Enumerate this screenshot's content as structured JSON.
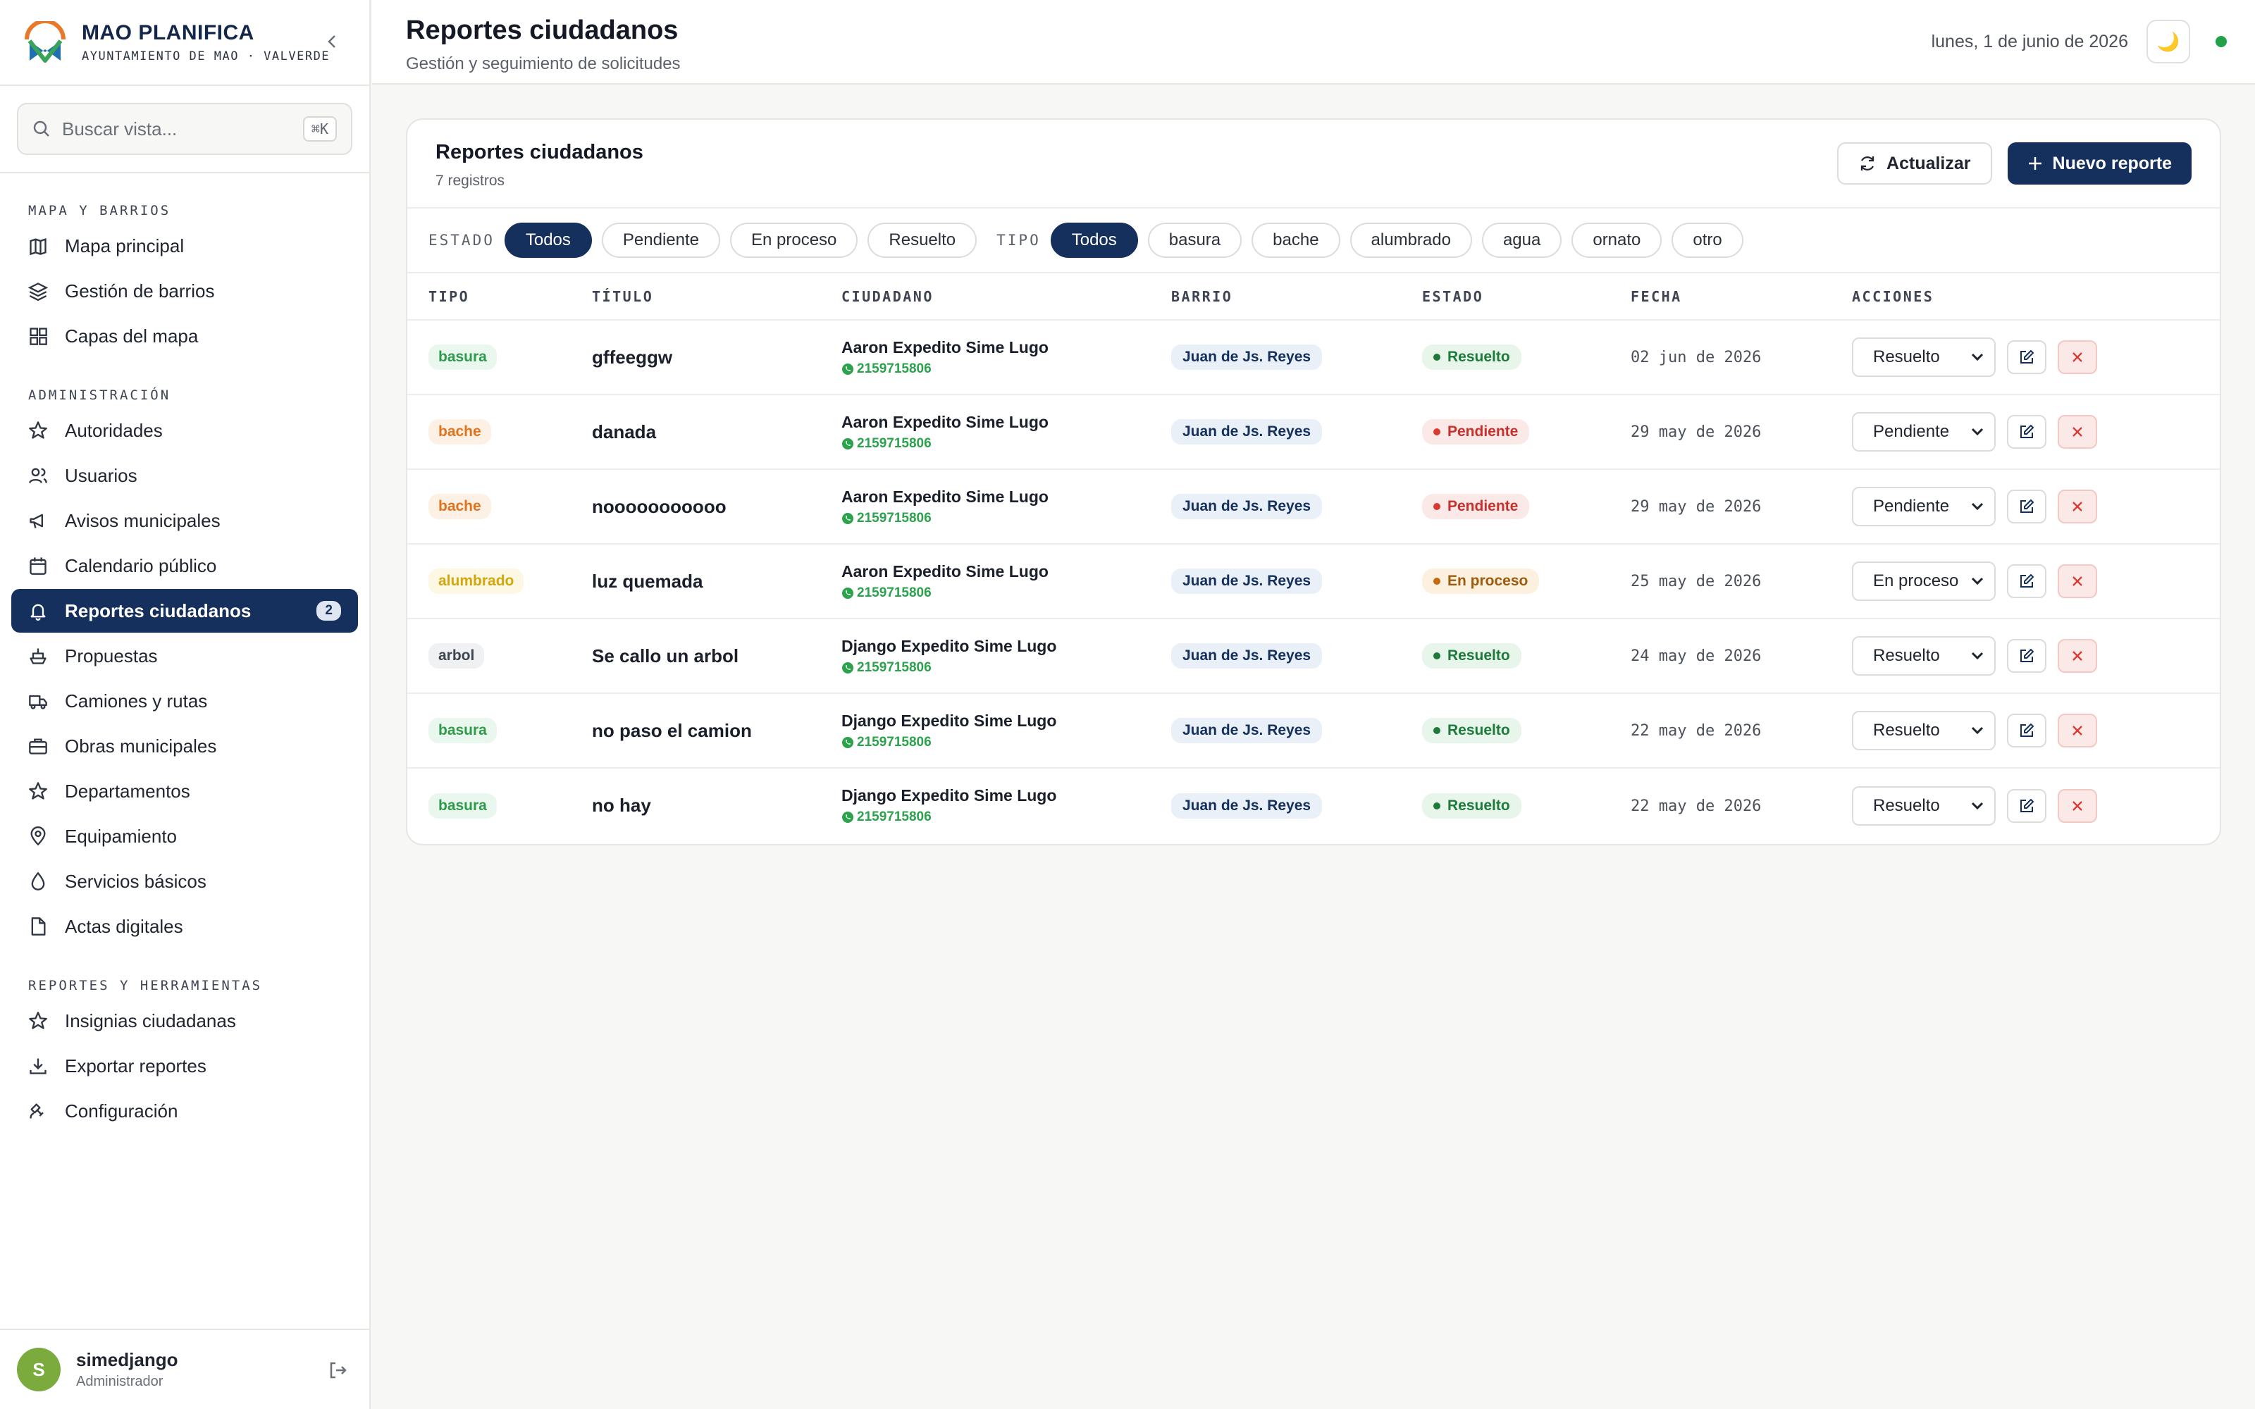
{
  "brand": {
    "title": "MAO PLANIFICA",
    "subtitle": "AYUNTAMIENTO DE MAO · VALVERDE"
  },
  "search": {
    "placeholder": "Buscar vista...",
    "shortcut": "⌘K"
  },
  "nav": [
    {
      "heading": "MAPA Y BARRIOS",
      "items": [
        {
          "label": "Mapa principal",
          "icon": "map-icon"
        },
        {
          "label": "Gestión de barrios",
          "icon": "layers-icon"
        },
        {
          "label": "Capas del mapa",
          "icon": "grid-icon"
        }
      ]
    },
    {
      "heading": "ADMINISTRACIÓN",
      "items": [
        {
          "label": "Autoridades",
          "icon": "star-icon"
        },
        {
          "label": "Usuarios",
          "icon": "users-icon"
        },
        {
          "label": "Avisos municipales",
          "icon": "megaphone-icon"
        },
        {
          "label": "Calendario público",
          "icon": "calendar-icon"
        },
        {
          "label": "Reportes ciudadanos",
          "icon": "bell-icon",
          "active": true,
          "badge": "2"
        },
        {
          "label": "Propuestas",
          "icon": "ship-icon"
        },
        {
          "label": "Camiones y rutas",
          "icon": "truck-icon"
        },
        {
          "label": "Obras municipales",
          "icon": "briefcase-icon"
        },
        {
          "label": "Departamentos",
          "icon": "star-icon"
        },
        {
          "label": "Equipamiento",
          "icon": "map-pin-icon"
        },
        {
          "label": "Servicios básicos",
          "icon": "droplet-icon"
        },
        {
          "label": "Actas digitales",
          "icon": "file-icon"
        }
      ]
    },
    {
      "heading": "REPORTES Y HERRAMIENTAS",
      "items": [
        {
          "label": "Insignias ciudadanas",
          "icon": "star-icon"
        },
        {
          "label": "Exportar reportes",
          "icon": "download-icon"
        },
        {
          "label": "Configuración",
          "icon": "satellite-icon"
        }
      ]
    }
  ],
  "user": {
    "initial": "S",
    "name": "simedjango",
    "role": "Administrador"
  },
  "header": {
    "title": "Reportes ciudadanos",
    "subtitle": "Gestión y seguimiento de solicitudes",
    "date": "lunes, 1 de junio de 2026",
    "theme_icon": "🌙"
  },
  "card": {
    "title": "Reportes ciudadanos",
    "count": "7 registros",
    "refresh_label": "Actualizar",
    "new_label": "Nuevo reporte"
  },
  "filters": {
    "estado_label": "ESTADO",
    "estado": [
      "Todos",
      "Pendiente",
      "En proceso",
      "Resuelto"
    ],
    "tipo_label": "TIPO",
    "tipo": [
      "Todos",
      "basura",
      "bache",
      "alumbrado",
      "agua",
      "ornato",
      "otro"
    ]
  },
  "columns": [
    "TIPO",
    "TÍTULO",
    "CIUDADANO",
    "BARRIO",
    "ESTADO",
    "FECHA",
    "ACCIONES"
  ],
  "rows": [
    {
      "tipo": "basura",
      "titulo": "gffeeggw",
      "ciudadano": "Aaron Expedito Sime Lugo",
      "telefono": "2159715806",
      "barrio": "Juan de Js. Reyes",
      "estado": "Resuelto",
      "fecha": "02 jun de 2026"
    },
    {
      "tipo": "bache",
      "titulo": "danada",
      "ciudadano": "Aaron Expedito Sime Lugo",
      "telefono": "2159715806",
      "barrio": "Juan de Js. Reyes",
      "estado": "Pendiente",
      "fecha": "29 may de 2026"
    },
    {
      "tipo": "bache",
      "titulo": "nooooooooooo",
      "ciudadano": "Aaron Expedito Sime Lugo",
      "telefono": "2159715806",
      "barrio": "Juan de Js. Reyes",
      "estado": "Pendiente",
      "fecha": "29 may de 2026"
    },
    {
      "tipo": "alumbrado",
      "titulo": "luz quemada",
      "ciudadano": "Aaron Expedito Sime Lugo",
      "telefono": "2159715806",
      "barrio": "Juan de Js. Reyes",
      "estado": "En proceso",
      "fecha": "25 may de 2026"
    },
    {
      "tipo": "arbol",
      "titulo": "Se callo un arbol",
      "ciudadano": "Django Expedito Sime Lugo",
      "telefono": "2159715806",
      "barrio": "Juan de Js. Reyes",
      "estado": "Resuelto",
      "fecha": "24 may de 2026"
    },
    {
      "tipo": "basura",
      "titulo": "no paso el camion",
      "ciudadano": "Django Expedito Sime Lugo",
      "telefono": "2159715806",
      "barrio": "Juan de Js. Reyes",
      "estado": "Resuelto",
      "fecha": "22 may de 2026"
    },
    {
      "tipo": "basura",
      "titulo": "no hay",
      "ciudadano": "Django Expedito Sime Lugo",
      "telefono": "2159715806",
      "barrio": "Juan de Js. Reyes",
      "estado": "Resuelto",
      "fecha": "22 may de 2026"
    }
  ],
  "colors": {
    "brand_navy": "#15305c",
    "resuelto": "#1d7a3a",
    "pendiente": "#c9302c",
    "en_proceso": "#a05a0c",
    "whatsapp": "#2ba24c"
  }
}
